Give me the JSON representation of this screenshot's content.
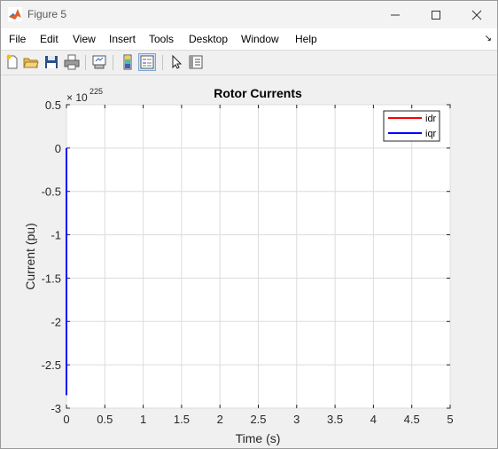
{
  "window": {
    "title": "Figure 5"
  },
  "menu": [
    "File",
    "Edit",
    "View",
    "Insert",
    "Tools",
    "Desktop",
    "Window",
    "Help"
  ],
  "toolbar": [
    "new-figure-icon",
    "open-file-icon",
    "save-icon",
    "print-icon",
    "link-plot-icon",
    "insert-colorbar-icon",
    "insert-legend-icon",
    "edit-plot-pointer-icon",
    "property-inspector-icon"
  ],
  "chart_data": {
    "type": "line",
    "title": "Rotor Currents",
    "xlabel": "Time (s)",
    "ylabel": "Current (pu)",
    "exponent_base": "× 10",
    "exponent_power": "225",
    "xlim": [
      0,
      5
    ],
    "ylim": [
      -3,
      0.5
    ],
    "xticks": [
      "0",
      "0.5",
      "1",
      "1.5",
      "2",
      "2.5",
      "3",
      "3.5",
      "4",
      "4.5",
      "5"
    ],
    "yticks": [
      "0.5",
      "0",
      "-0.5",
      "-1",
      "-1.5",
      "-2",
      "-2.5",
      "-3"
    ],
    "grid": true,
    "legend_position": "top-right",
    "series": [
      {
        "name": "idr",
        "color": "#ff0000",
        "x": [
          0,
          0
        ],
        "y": [
          0,
          0
        ]
      },
      {
        "name": "iqr",
        "color": "#0000ff",
        "x": [
          0,
          0,
          0
        ],
        "y": [
          0,
          -1.5,
          -2.85
        ]
      }
    ]
  }
}
